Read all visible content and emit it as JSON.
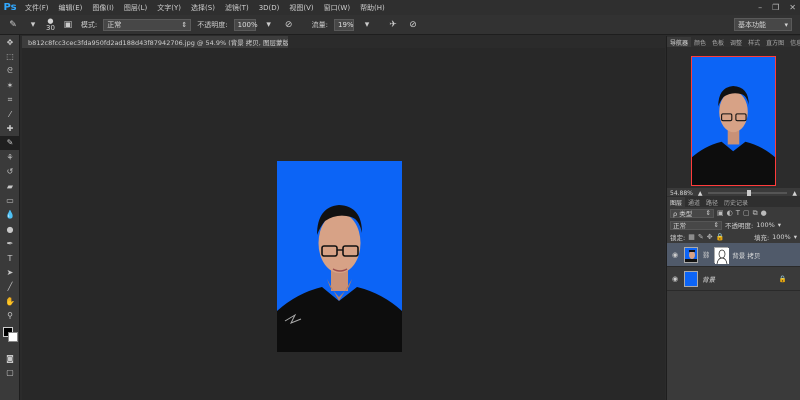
{
  "app": {
    "logo": "Ps"
  },
  "menu": [
    "文件(F)",
    "编辑(E)",
    "图像(I)",
    "图层(L)",
    "文字(Y)",
    "选择(S)",
    "滤镜(T)",
    "3D(D)",
    "视图(V)",
    "窗口(W)",
    "帮助(H)"
  ],
  "window_controls": {
    "minimize": "–",
    "restore": "❐",
    "close": "✕"
  },
  "options": {
    "brush_size": "30",
    "mode_label": "模式:",
    "mode_value": "正常",
    "opacity_label": "不透明度:",
    "opacity_value": "100%",
    "flow_label": "流量:",
    "flow_value": "19%",
    "workspace": "基本功能"
  },
  "document": {
    "tab_title": "b812c8fcc3cec3fda950fd2ad188d43f87942706.jpg @ 54.9% (背景 拷贝, 图层蒙版/8) *"
  },
  "navigator": {
    "tabs": [
      "导航器",
      "颜色",
      "色板",
      "调整",
      "样式",
      "直方图",
      "信息"
    ],
    "zoom": "54.88%"
  },
  "layers": {
    "tabs": [
      "图层",
      "通道",
      "路径",
      "历史记录"
    ],
    "filter": "ρ 类型",
    "blend_mode": "正常",
    "opacity_label": "不透明度:",
    "opacity_value": "100%",
    "lock_label": "锁定:",
    "fill_label": "填充:",
    "fill_value": "100%",
    "items": [
      {
        "name": "背景 拷贝",
        "selected": true
      },
      {
        "name": "背景",
        "selected": false
      }
    ]
  },
  "colors": {
    "canvas_blue": "#0c64f6",
    "accent": "#31a8ff",
    "nav_frame": "#ff3b3b"
  },
  "icons": {
    "tools": [
      "move-icon",
      "marquee-icon",
      "lasso-icon",
      "magic-wand-icon",
      "crop-icon",
      "eyedropper-icon",
      "healing-icon",
      "brush-icon",
      "stamp-icon",
      "history-brush-icon",
      "eraser-icon",
      "gradient-icon",
      "blur-icon",
      "dodge-icon",
      "pen-icon",
      "type-icon",
      "path-select-icon",
      "line-icon",
      "hand-icon",
      "zoom-icon"
    ]
  }
}
